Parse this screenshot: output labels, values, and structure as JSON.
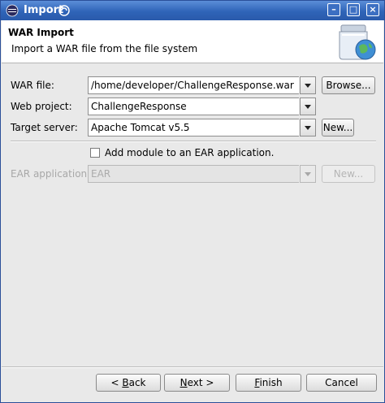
{
  "window": {
    "title": "Import",
    "controls": {
      "minimize": "–",
      "maximize": "□",
      "close": "×"
    }
  },
  "banner": {
    "heading": "WAR Import",
    "description": "Import a WAR file from the file system",
    "icon": "jar-globe-icon"
  },
  "form": {
    "war_file": {
      "label": "WAR file:",
      "value": "/home/developer/ChallengeResponse.war",
      "button": "Browse..."
    },
    "web_project": {
      "label": "Web project:",
      "value": "ChallengeResponse"
    },
    "target_server": {
      "label": "Target server:",
      "value": "Apache Tomcat v5.5",
      "button": "New..."
    },
    "ear_checkbox": {
      "label": "Add module to an EAR application.",
      "checked": false
    },
    "ear_application": {
      "label": "EAR application:",
      "value": "EAR",
      "button": "New..."
    }
  },
  "footer": {
    "back": {
      "prefix": "< ",
      "mnemonic": "B",
      "rest": "ack"
    },
    "next": {
      "mnemonic": "N",
      "rest": "ext >"
    },
    "finish": {
      "mnemonic": "F",
      "rest": "inish"
    },
    "cancel": "Cancel"
  }
}
